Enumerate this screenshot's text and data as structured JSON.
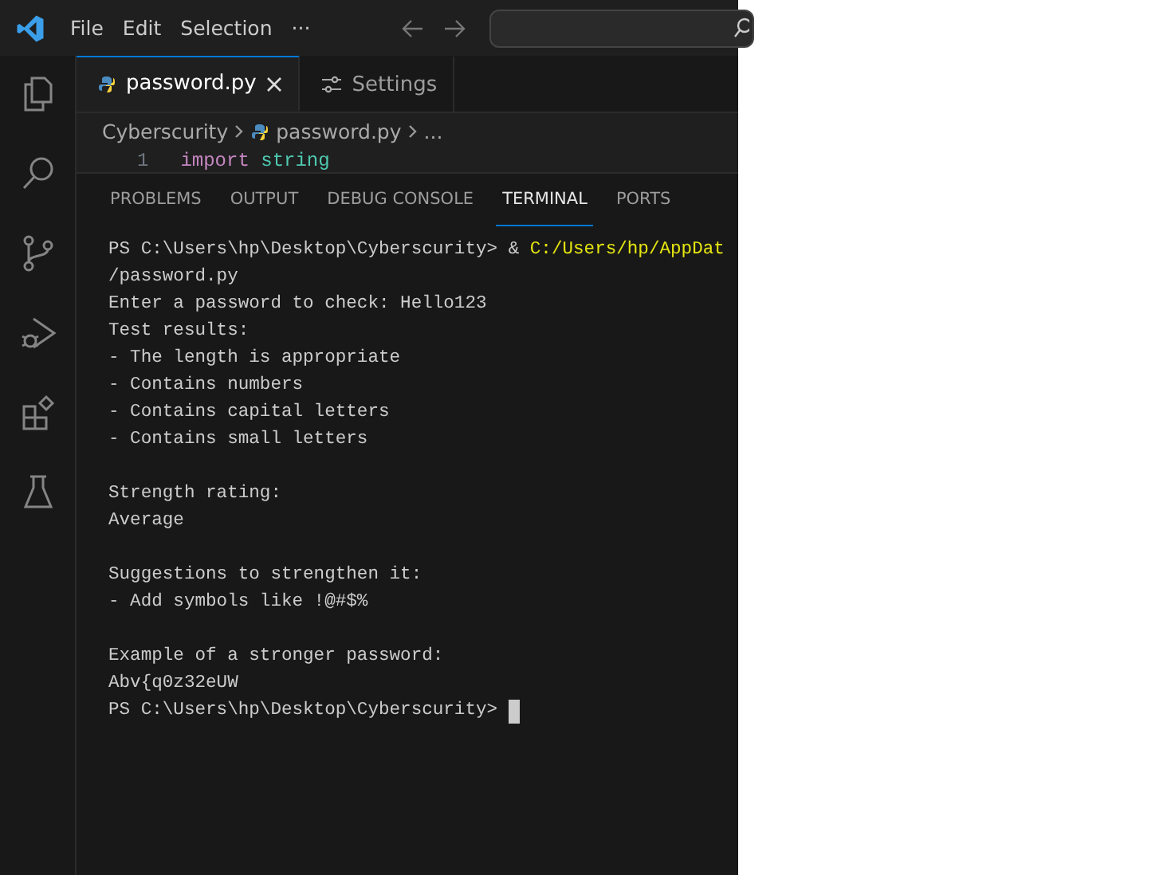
{
  "title_bar": {
    "menu": [
      "File",
      "Edit",
      "Selection",
      "···"
    ]
  },
  "activity_bar": {
    "items": [
      {
        "kind": "files",
        "selected": false
      },
      {
        "kind": "search",
        "selected": false
      },
      {
        "kind": "source-control",
        "selected": false
      },
      {
        "kind": "run-debug",
        "selected": false
      },
      {
        "kind": "extensions",
        "selected": false
      },
      {
        "kind": "testing",
        "selected": false
      }
    ]
  },
  "editor_tabs": [
    {
      "label": "password.py",
      "kind": "python",
      "selected": true
    },
    {
      "label": "Settings",
      "kind": "settings",
      "selected": false
    }
  ],
  "breadcrumb": [
    "Cyberscurity",
    "password.py",
    "..."
  ],
  "code_lines": [
    {
      "number": "1",
      "keyword": "import",
      "name": "string"
    }
  ],
  "panel_tabs": [
    {
      "label": "PROBLEMS",
      "selected": false
    },
    {
      "label": "OUTPUT",
      "selected": false
    },
    {
      "label": "DEBUG CONSOLE",
      "selected": false
    },
    {
      "label": "TERMINAL",
      "selected": true
    },
    {
      "label": "PORTS",
      "selected": false
    }
  ],
  "terminal_lines": [
    {
      "kind": "command",
      "text": "PS C:\\Users\\hp\\Desktop\\Cyberscurity> &",
      "path": "C:/Users/hp/AppDat"
    },
    {
      "kind": "output",
      "text": "/password.py"
    },
    {
      "kind": "output",
      "text": "Enter a password to check: Hello123"
    },
    {
      "kind": "output",
      "text": "Test results:"
    },
    {
      "kind": "output",
      "text": "- The length is appropriate"
    },
    {
      "kind": "output",
      "text": "- Contains numbers"
    },
    {
      "kind": "output",
      "text": "- Contains capital letters"
    },
    {
      "kind": "output",
      "text": "- Contains small letters"
    },
    {
      "kind": "blank"
    },
    {
      "kind": "output",
      "text": "Strength rating:"
    },
    {
      "kind": "output",
      "text": "Average"
    },
    {
      "kind": "blank"
    },
    {
      "kind": "output",
      "text": "Suggestions to strengthen it:"
    },
    {
      "kind": "output",
      "text": "- Add symbols like !@#$%"
    },
    {
      "kind": "blank"
    },
    {
      "kind": "output",
      "text": "Example of a stronger password:"
    },
    {
      "kind": "output",
      "text": "Abv{q0z32eUW"
    },
    {
      "kind": "prompt",
      "text": "PS C:\\Users\\hp\\Desktop\\Cyberscurity>",
      "cursor": true
    }
  ]
}
